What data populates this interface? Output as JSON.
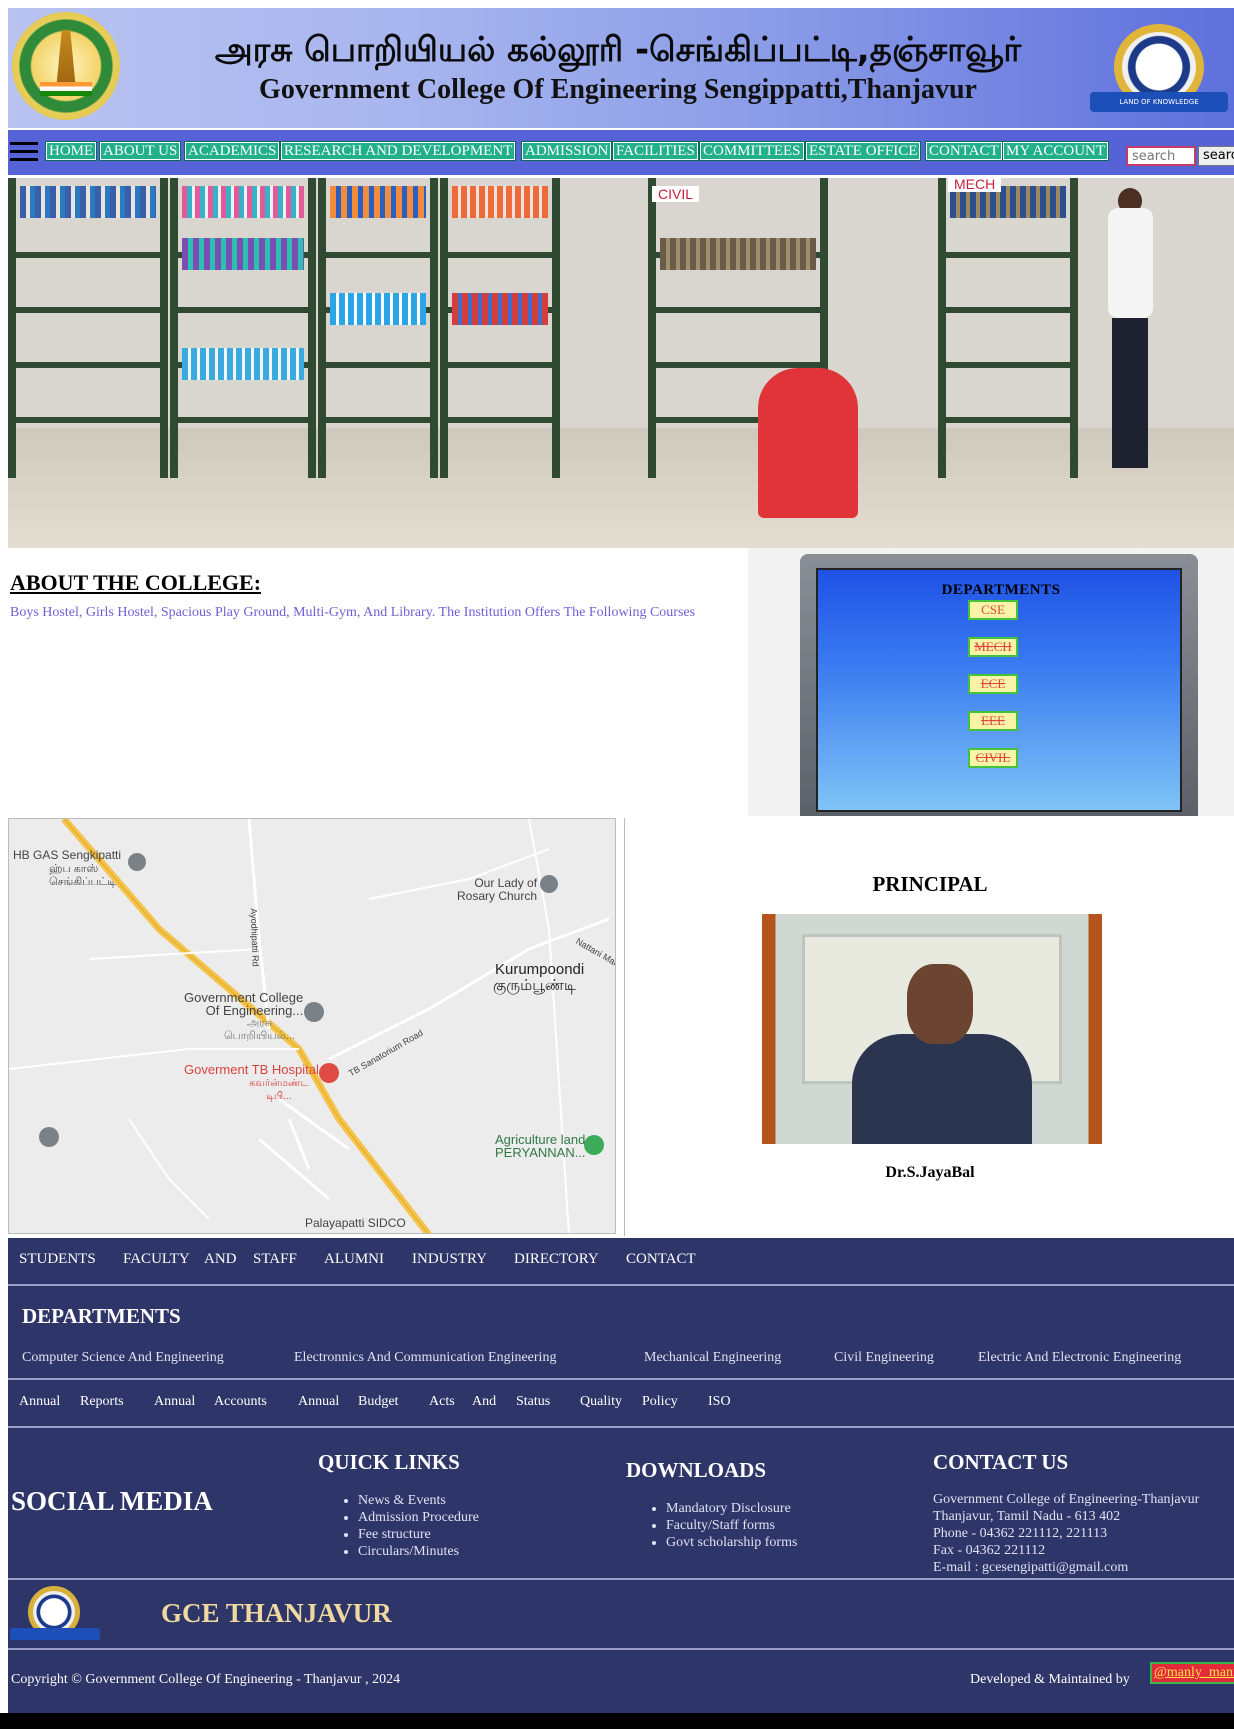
{
  "header": {
    "title_tamil": "அரசு பொறியியல் கல்லூரி -செங்கிப்பட்டி,தஞ்சாவூர்",
    "title_english": "Government College Of Engineering Sengippatti,Thanjavur",
    "left_emblem_icon": "tamilnadu-government-emblem",
    "right_emblem_icon": "gce-land-of-knowledge-logo"
  },
  "nav": {
    "items": [
      "HOME",
      "ABOUT US",
      "ACADEMICS",
      "RESEARCH AND DEVELOPMENT",
      "ADMISSION",
      "FACILITIES",
      "COMMITTEES",
      "ESTATE OFFICE",
      "CONTACT",
      "MY ACCOUNT"
    ],
    "search_placeholder": "search",
    "search_button": "search"
  },
  "hero": {
    "signs": [
      "CIVIL",
      "MECH"
    ]
  },
  "about": {
    "heading": "ABOUT THE COLLEGE:",
    "text": "Boys Hostel, Girls Hostel, Spacious Play Ground, Multi-Gym, And Library. The Institution Offers The Following Courses"
  },
  "departments_panel": {
    "title": "DEPARTMENTS",
    "buttons": [
      "CSE",
      "MECH",
      "ECE",
      "EEE",
      "CIVIL"
    ]
  },
  "map": {
    "labels": {
      "hb_gas": "HB GAS Sengkipatti",
      "hb_gas_tamil": "ஹ்ப காஸ்\nசெங்கிப்பட்டி",
      "church": "Our Lady of\nRosary Church",
      "kurumpoondi": "Kurumpoondi",
      "kurumpoondi_tamil": "குரும்பூண்டி",
      "college": "Government College\nOf Engineering...",
      "college_tamil": "அரசு\nபொறியியல்...",
      "hospital": "Goverment TB Hospital",
      "hospital_tamil": "கவர்ன்மண்ட\nடிபி...",
      "agri": "Agriculture land\nPERYANNAN...",
      "sidco": "Palayapatti SIDCO",
      "road_tb": "TB Sanatorium Road",
      "road_ayodhi": "Ayodhipatti Rd",
      "road_nattani": "Nattani Main"
    }
  },
  "principal": {
    "title": "PRINCIPAL",
    "name": "Dr.S.JayaBal"
  },
  "footer": {
    "top_links": [
      "STUDENTS",
      "FACULTY",
      "AND",
      "STAFF",
      "ALUMNI",
      "INDUSTRY",
      "DIRECTORY",
      "CONTACT"
    ],
    "departments_title": "DEPARTMENTS",
    "departments": [
      "Computer Science And Engineering",
      "Electronnics And Communication Engineering",
      "Mechanical Engineering",
      "Civil Engineering",
      "Electric And Electronic Engineering"
    ],
    "report_links": [
      "Annual",
      "Reports",
      "Annual",
      "Accounts",
      "Annual",
      "Budget",
      "Acts",
      "And",
      "Status",
      "Quality",
      "Policy",
      "ISO"
    ],
    "social_title": "SOCIAL MEDIA",
    "quick_links_title": "QUICK LINKS",
    "quick_links": [
      "News & Events",
      "Admission Procedure",
      "Fee structure",
      "Circulars/Minutes"
    ],
    "downloads_title": "DOWNLOADS",
    "downloads": [
      "Mandatory Disclosure",
      "Faculty/Staff forms",
      "Govt scholarship forms"
    ],
    "contact_title": "CONTACT US",
    "contact_lines": [
      "Government College of Engineering-Thanjavur",
      "Thanjavur, Tamil Nadu - 613 402",
      "Phone - 04362 221112, 221113",
      "Fax - 04362 221112",
      "E-mail : gcesengipatti@gmail.com"
    ],
    "brand": "GCE THANJAVUR",
    "copyright": "Copyright © Government College Of Engineering - Thanjavur , 2024",
    "developed_by": "Developed & Maintained by",
    "developer": "@manly_mani"
  },
  "colors": {
    "nav_bg": "#5563d6",
    "nav_item_bg": "#22b08c",
    "footer_bg": "#2e3568",
    "brand_gold": "#f0d9a0"
  }
}
